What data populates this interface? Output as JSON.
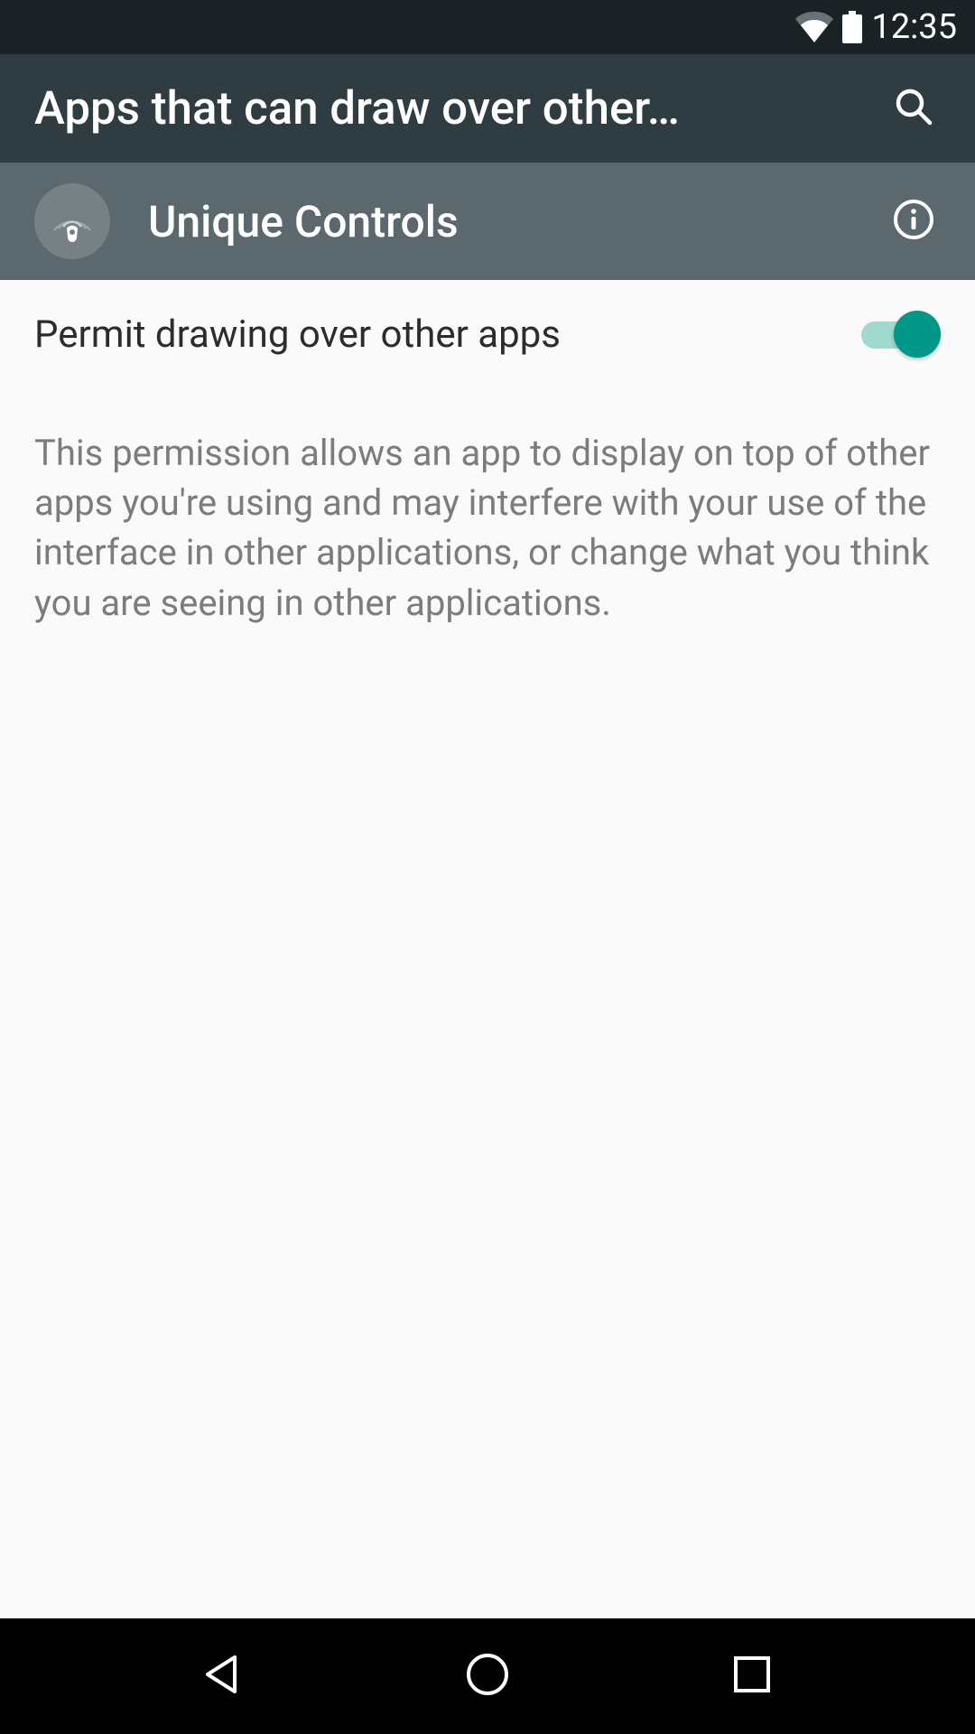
{
  "status_bar": {
    "time": "12:35"
  },
  "app_bar": {
    "title": "Apps that can draw over other…"
  },
  "app_header": {
    "app_name": "Unique Controls"
  },
  "setting": {
    "label": "Permit drawing over other apps",
    "enabled": true
  },
  "description": "This permission allows an app to display on top of other apps you're using and may interfere with your use of the interface in other applications, or change what you think you are seeing in other applications.",
  "colors": {
    "status_bg": "#1a2226",
    "appbar_bg": "#2f3c42",
    "header_bg": "#5b696f",
    "accent": "#009688",
    "accent_light": "#a1d9cf"
  }
}
